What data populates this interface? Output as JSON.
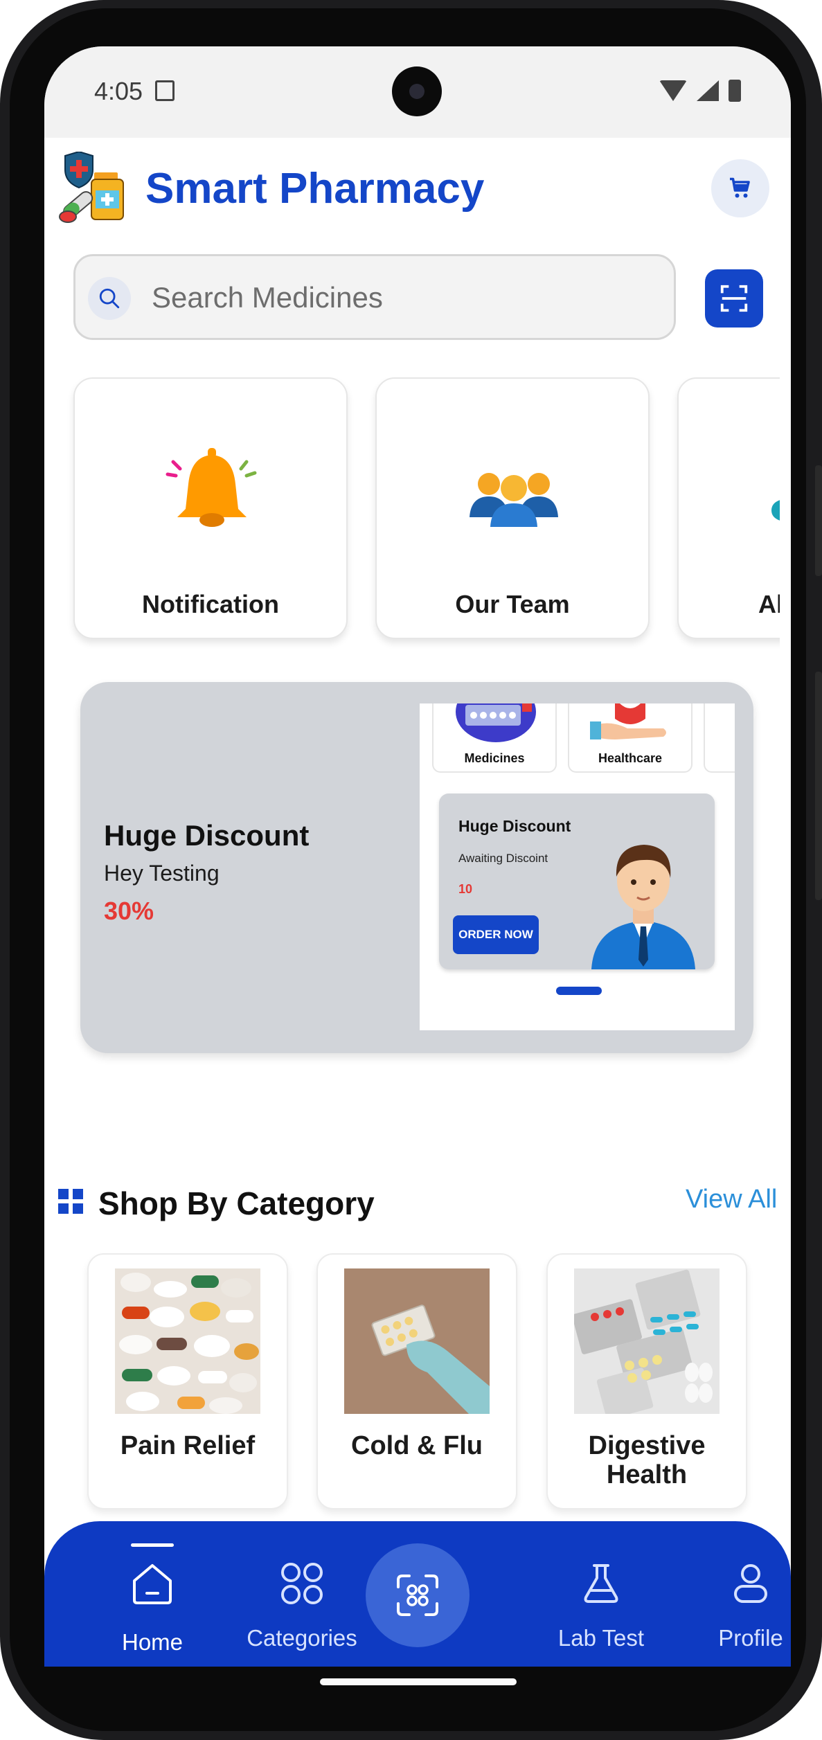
{
  "status_bar": {
    "time": "4:05"
  },
  "header": {
    "title": "Smart Pharmacy"
  },
  "search": {
    "placeholder": "Search Medicines"
  },
  "quick_actions": [
    {
      "label": "Notification",
      "icon": "bell-icon"
    },
    {
      "label": "Our Team",
      "icon": "team-icon"
    },
    {
      "label": "Al",
      "icon": "partial-icon"
    }
  ],
  "banner": {
    "title": "Huge Discount",
    "subtitle": "Hey Testing",
    "discount": "30%",
    "preview": {
      "categories": [
        "Medicines",
        "Healthcare"
      ],
      "card_title": "Huge Discount",
      "card_subtitle": "Awaiting Discoint",
      "card_value": "10",
      "button_label": "ORDER NOW"
    }
  },
  "categories_section": {
    "title": "Shop By Category",
    "view_all": "View All",
    "items": [
      {
        "label": "Pain Relief"
      },
      {
        "label": "Cold & Flu"
      },
      {
        "label": "Digestive Health"
      }
    ]
  },
  "bottom_nav": {
    "items": [
      {
        "label": "Home",
        "icon": "home-icon",
        "active": true
      },
      {
        "label": "Categories",
        "icon": "grid-icon",
        "active": false
      },
      {
        "label": "",
        "icon": "scan-icon",
        "active": false
      },
      {
        "label": "Lab Test",
        "icon": "flask-icon",
        "active": false
      },
      {
        "label": "Profile",
        "icon": "user-icon",
        "active": false
      }
    ]
  },
  "colors": {
    "brand": "#1446c8",
    "nav_bg": "#0e3ac2",
    "discount_red": "#e53935",
    "link_blue": "#2b8fd9",
    "banner_bg": "#d1d4d9"
  }
}
